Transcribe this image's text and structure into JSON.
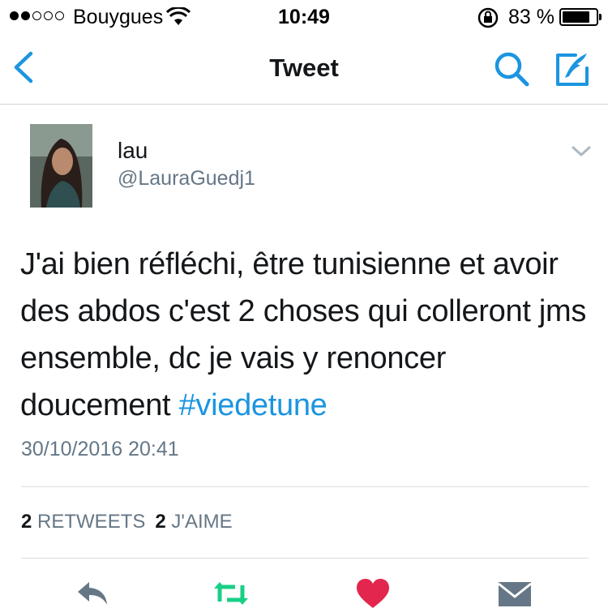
{
  "status_bar": {
    "carrier": "Bouygues",
    "time": "10:49",
    "battery_percent": "83 %",
    "battery_level": 0.83,
    "signal_bars_filled": 2,
    "signal_bars_total": 5
  },
  "nav": {
    "title": "Tweet",
    "back_icon": "chevron-left-icon",
    "search_icon": "search-icon",
    "compose_icon": "compose-icon",
    "accent_color": "#1b95e0"
  },
  "tweet": {
    "display_name": "lau",
    "handle": "@LauraGuedj1",
    "text": "J'ai bien réfléchi, être tunisienne et avoir des abdos c'est 2 choses qui colleront jms ensemble, dc je vais y renoncer doucement ",
    "hashtag": "#viedetune",
    "timestamp": "30/10/2016 20:41"
  },
  "stats": {
    "retweets_count": "2",
    "retweets_label": "RETWEETS",
    "likes_count": "2",
    "likes_label": "J'AIME"
  },
  "actions": {
    "reply_icon": "reply-icon",
    "retweet_icon": "retweet-icon",
    "retweet_color": "#19cf86",
    "like_icon": "heart-icon",
    "like_color": "#e2264d",
    "dm_icon": "envelope-icon"
  }
}
